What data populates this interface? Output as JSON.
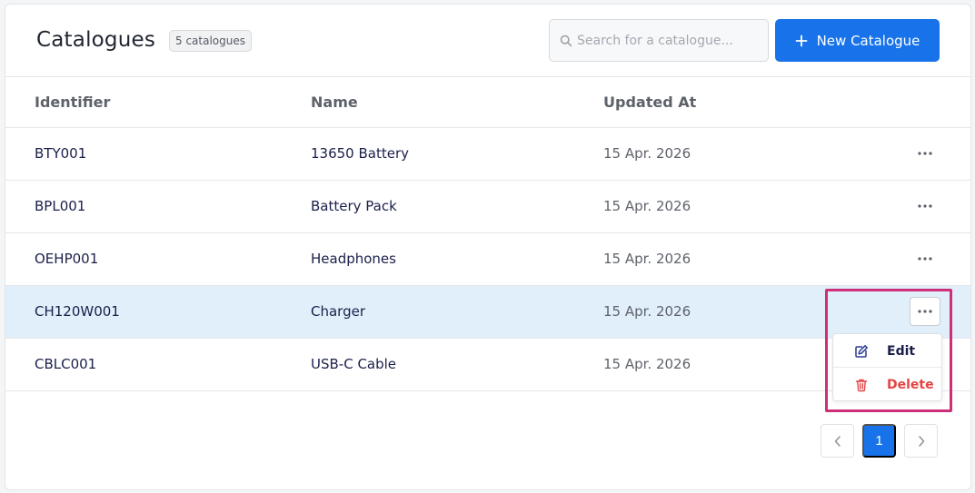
{
  "header": {
    "title": "Catalogues",
    "count_badge": "5 catalogues",
    "search_placeholder": "Search for a catalogue...",
    "search_value": "",
    "new_button_label": "New Catalogue"
  },
  "table": {
    "columns": [
      "Identifier",
      "Name",
      "Updated At"
    ],
    "rows": [
      {
        "identifier": "BTY001",
        "name": "13650 Battery",
        "updated_at": "15 Apr. 2026"
      },
      {
        "identifier": "BPL001",
        "name": "Battery Pack",
        "updated_at": "15 Apr. 2026"
      },
      {
        "identifier": "OEHP001",
        "name": "Headphones",
        "updated_at": "15 Apr. 2026"
      },
      {
        "identifier": "CH120W001",
        "name": "Charger",
        "updated_at": "15 Apr. 2026"
      },
      {
        "identifier": "CBLC001",
        "name": "USB-C Cable",
        "updated_at": "15 Apr. 2026"
      }
    ],
    "active_row_index": 3
  },
  "row_menu": {
    "edit_label": "Edit",
    "delete_label": "Delete"
  },
  "pagination": {
    "current_page": "1"
  },
  "icons": {
    "search": "search-icon",
    "plus": "plus-icon",
    "more": "more-horizontal-icon",
    "edit": "edit-icon",
    "delete": "trash-icon",
    "prev": "chevron-left-icon",
    "next": "chevron-right-icon"
  },
  "colors": {
    "primary": "#1873ea",
    "active_row": "#e1effb",
    "danger": "#e34545",
    "highlight": "#cf2e78",
    "text_dark": "#1a1f4a"
  }
}
